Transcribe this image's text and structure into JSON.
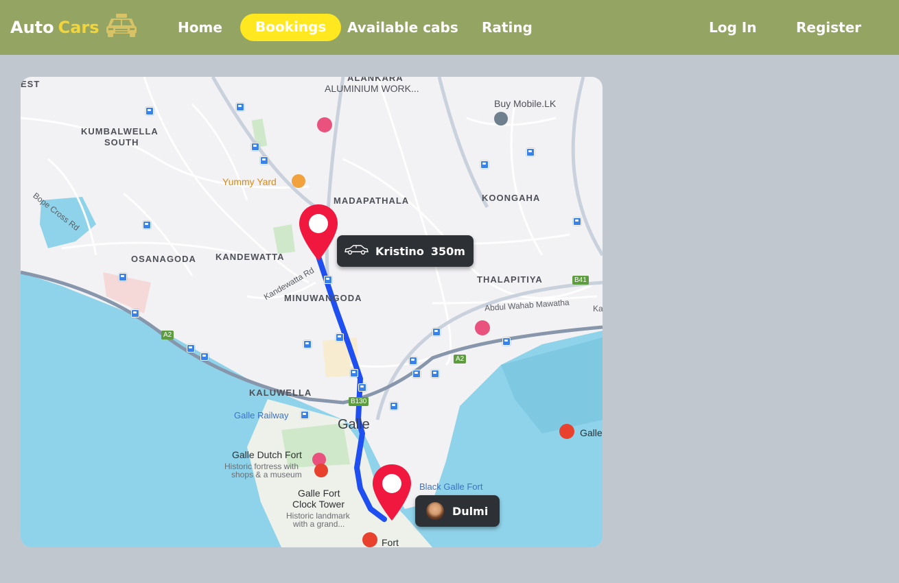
{
  "header": {
    "brand_auto": "Auto",
    "brand_cars": "Cars",
    "brand_icon": "taxi-icon",
    "nav": {
      "home": "Home",
      "bookings": "Bookings",
      "available_cabs": "Available cabs",
      "rating": "Rating",
      "login": "Log In",
      "register": "Register"
    }
  },
  "map": {
    "labels": {
      "est": "EST",
      "alankara": "ALANKARA",
      "aluminium": "ALUMINIUM WORK...",
      "buy_mobile": "Buy Mobile.LK",
      "kumbalwella": "KUMBALWELLA",
      "south": "SOUTH",
      "yummy_yard": "Yummy Yard",
      "madapathala": "MADAPATHALA",
      "koongaha": "KOONGAHA",
      "bope_cross": "Bope Cross Rd",
      "osanagoda": "OSANAGODA",
      "kandewatta": "KANDEWATTA",
      "kandewatta_rd": "Kandewatta Rd",
      "thalapitiya": "THALAPITIYA",
      "b41": "B41",
      "minuwangoda": "MINUWANGODA",
      "abdul_wahab": "Abdul Wahab Mawatha",
      "ka": "Ka",
      "a2_left": "A2",
      "a2_right": "A2",
      "kaluwella": "KALUWELLA",
      "b130": "B130",
      "galle_railway": "Galle Railway",
      "galle": "Galle",
      "galle_right": "Galle",
      "dutch_fort": "Galle Dutch Fort",
      "dutch_fort_desc_1": "Historic fortress with",
      "dutch_fort_desc_2": "shops & a museum",
      "black_galle_fort": "Black Galle Fort",
      "clock_tower_1": "Galle Fort",
      "clock_tower_2": "Clock Tower",
      "clock_desc_1": "Historic landmark",
      "clock_desc_2": "with a grand...",
      "fort": "Fort"
    },
    "driver": {
      "name": "Kristino",
      "distance": "350m",
      "icon": "car-icon"
    },
    "rider": {
      "name": "Dulmi",
      "icon": "avatar"
    },
    "colors": {
      "route": "#1f4ff0",
      "pin": "#f0183f",
      "sea": "#8fd3ea"
    }
  }
}
